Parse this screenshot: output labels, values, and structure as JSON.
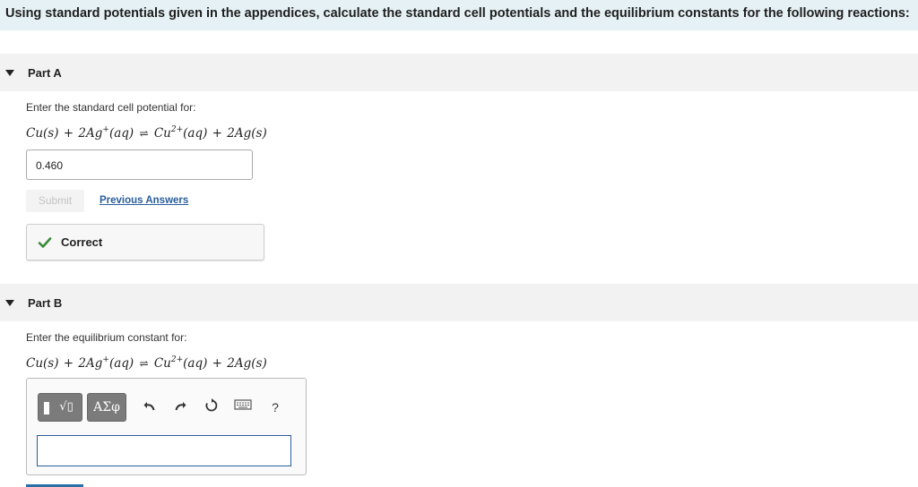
{
  "question": {
    "text": "Using standard potentials given in the appendices, calculate the standard cell potentials and the equilibrium constants for the following reactions:"
  },
  "part_a": {
    "title": "Part A",
    "prompt": "Enter the standard cell potential for:",
    "equation": {
      "lhs1": "Cu(s)",
      "plus1": "+",
      "lhs2": "2Ag",
      "lhs2_sup": "+",
      "lhs2_tail": "(aq)",
      "arrow": "⇌",
      "rhs1": "Cu",
      "rhs1_sup": "2+",
      "rhs1_tail": "(aq)",
      "plus2": "+",
      "rhs2": "2Ag(s)"
    },
    "answer_value": "0.460",
    "submit_label": "Submit",
    "previous_answers_label": "Previous Answers",
    "feedback": "Correct",
    "feedback_color": "#3b8a3b"
  },
  "part_b": {
    "title": "Part B",
    "prompt": "Enter the equilibrium constant for:",
    "equation": {
      "lhs1": "Cu(s)",
      "plus1": "+",
      "lhs2": "2Ag",
      "lhs2_sup": "+",
      "lhs2_tail": "(aq)",
      "arrow": "⇌",
      "rhs1": "Cu",
      "rhs1_sup": "2+",
      "rhs1_tail": "(aq)",
      "plus2": "+",
      "rhs2": "2Ag(s)"
    },
    "toolbar": {
      "templates_label": "√▯",
      "symbols_label": "ΑΣφ",
      "help_label": "?",
      "icons": [
        "templates-icon",
        "greek-symbols-icon",
        "undo-icon",
        "redo-icon",
        "reset-icon",
        "keyboard-icon",
        "help-icon"
      ]
    },
    "answer_value": ""
  },
  "colors": {
    "header_bg": "#e6f1f5",
    "part_bar_bg": "#f2f2f2",
    "link": "#2a5e9c",
    "input_border": "#2a5e9c"
  }
}
